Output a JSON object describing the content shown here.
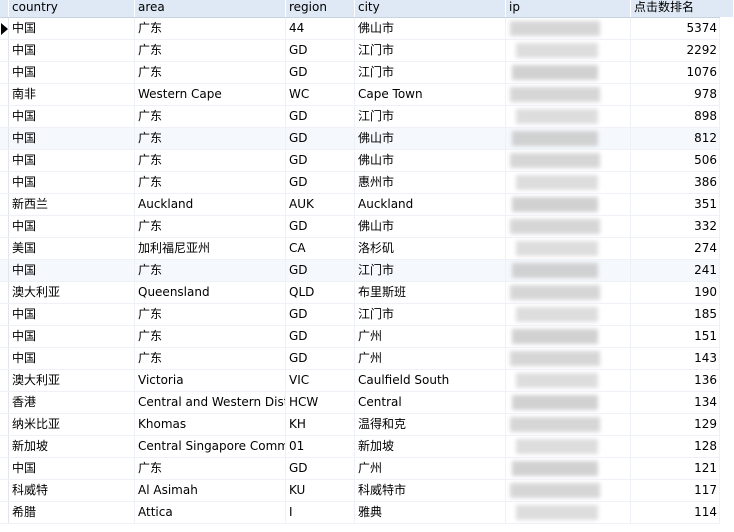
{
  "columns": {
    "country": "country",
    "area": "area",
    "region": "region",
    "city": "city",
    "ip": "ip",
    "rank": "点击数排名"
  },
  "rows": [
    {
      "country": "中国",
      "area": "广东",
      "region": "44",
      "city": "佛山市",
      "rank": "5374"
    },
    {
      "country": "中国",
      "area": "广东",
      "region": "GD",
      "city": "江门市",
      "rank": "2292"
    },
    {
      "country": "中国",
      "area": "广东",
      "region": "GD",
      "city": "江门市",
      "rank": "1076"
    },
    {
      "country": "南非",
      "area": "Western Cape",
      "region": "WC",
      "city": "Cape Town",
      "rank": "978"
    },
    {
      "country": "中国",
      "area": "广东",
      "region": "GD",
      "city": "江门市",
      "rank": "898"
    },
    {
      "country": "中国",
      "area": "广东",
      "region": "GD",
      "city": "佛山市",
      "rank": "812"
    },
    {
      "country": "中国",
      "area": "广东",
      "region": "GD",
      "city": "佛山市",
      "rank": "506"
    },
    {
      "country": "中国",
      "area": "广东",
      "region": "GD",
      "city": "惠州市",
      "rank": "386"
    },
    {
      "country": "新西兰",
      "area": "Auckland",
      "region": "AUK",
      "city": "Auckland",
      "rank": "351"
    },
    {
      "country": "中国",
      "area": "广东",
      "region": "GD",
      "city": "佛山市",
      "rank": "332"
    },
    {
      "country": "美国",
      "area": "加利福尼亚州",
      "region": "CA",
      "city": "洛杉矶",
      "rank": "274"
    },
    {
      "country": "中国",
      "area": "广东",
      "region": "GD",
      "city": "江门市",
      "rank": "241"
    },
    {
      "country": "澳大利亚",
      "area": "Queensland",
      "region": "QLD",
      "city": "布里斯班",
      "rank": "190"
    },
    {
      "country": "中国",
      "area": "广东",
      "region": "GD",
      "city": "江门市",
      "rank": "185"
    },
    {
      "country": "中国",
      "area": "广东",
      "region": "GD",
      "city": "广州",
      "rank": "151"
    },
    {
      "country": "中国",
      "area": "广东",
      "region": "GD",
      "city": "广州",
      "rank": "143"
    },
    {
      "country": "澳大利亚",
      "area": "Victoria",
      "region": "VIC",
      "city": "Caulfield South",
      "rank": "136"
    },
    {
      "country": "香港",
      "area": "Central and Western District",
      "region": "HCW",
      "city": "Central",
      "rank": "134"
    },
    {
      "country": "纳米比亚",
      "area": "Khomas",
      "region": "KH",
      "city": "温得和克",
      "rank": "129"
    },
    {
      "country": "新加坡",
      "area": "Central Singapore Community",
      "region": "01",
      "city": "新加坡",
      "rank": "128"
    },
    {
      "country": "中国",
      "area": "广东",
      "region": "GD",
      "city": "广州",
      "rank": "121"
    },
    {
      "country": "科威特",
      "area": "Al Asimah",
      "region": "KU",
      "city": "科威特市",
      "rank": "117"
    },
    {
      "country": "希腊",
      "area": "Attica",
      "region": "I",
      "city": "雅典",
      "rank": "114"
    }
  ]
}
